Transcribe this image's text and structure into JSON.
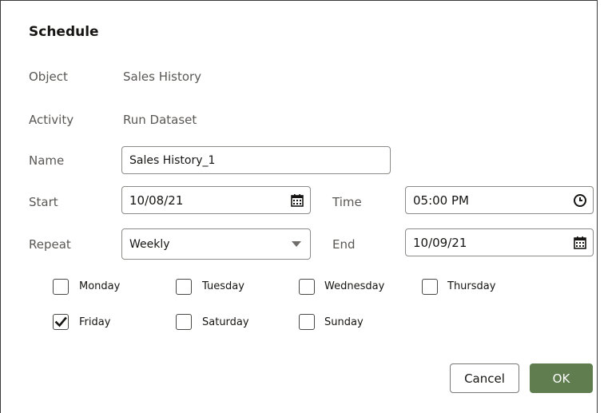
{
  "dialog": {
    "title": "Schedule"
  },
  "form": {
    "object_label": "Object",
    "object_value": "Sales History",
    "activity_label": "Activity",
    "activity_value": "Run Dataset",
    "name_label": "Name",
    "name_value": "Sales History_1",
    "start_label": "Start",
    "start_value": "10/08/21",
    "time_label": "Time",
    "time_value": "05:00 PM",
    "repeat_label": "Repeat",
    "repeat_value": "Weekly",
    "end_label": "End",
    "end_value": "10/09/21"
  },
  "days": [
    {
      "label": "Monday",
      "checked": false
    },
    {
      "label": "Tuesday",
      "checked": false
    },
    {
      "label": "Wednesday",
      "checked": false
    },
    {
      "label": "Thursday",
      "checked": false
    },
    {
      "label": "Friday",
      "checked": true
    },
    {
      "label": "Saturday",
      "checked": false
    },
    {
      "label": "Sunday",
      "checked": false
    }
  ],
  "buttons": {
    "cancel": "Cancel",
    "ok": "OK"
  },
  "icons": {
    "start": "calendar-icon",
    "time": "clock-icon",
    "repeat": "chevron-down-icon",
    "end": "calendar-icon"
  },
  "colors": {
    "primary": "#5f7d4f",
    "border": "#8c8a87"
  }
}
